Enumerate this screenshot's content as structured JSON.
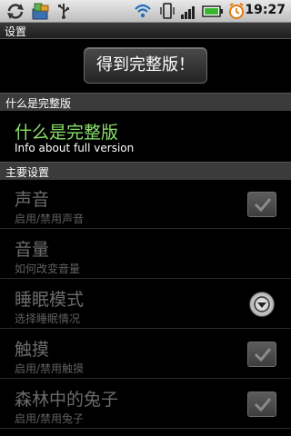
{
  "status_bar": {
    "time": "19:27"
  },
  "title_bar": {
    "title": "设置"
  },
  "full_version_button": {
    "label": "得到完整版！"
  },
  "sections": {
    "full_version": "什么是完整版",
    "main_settings": "主要设置"
  },
  "info": {
    "title": "什么是完整版",
    "subtitle": "Info about full version"
  },
  "prefs": [
    {
      "title": "声音",
      "subtitle": "启用/禁用声音",
      "control": "checkbox",
      "checked": true
    },
    {
      "title": "音量",
      "subtitle": "如何改变音量",
      "control": "none"
    },
    {
      "title": "睡眠模式",
      "subtitle": "选择睡眠情况",
      "control": "dropdown"
    },
    {
      "title": "触摸",
      "subtitle": "启用/禁用触摸",
      "control": "checkbox",
      "checked": true
    },
    {
      "title": "森林中的兔子",
      "subtitle": "启用/禁用兔子",
      "control": "checkbox",
      "checked": true
    }
  ],
  "colors": {
    "accent_green": "#8be36b",
    "disabled_text": "#6b6b6b",
    "section_bg": "#3b3b3b"
  }
}
